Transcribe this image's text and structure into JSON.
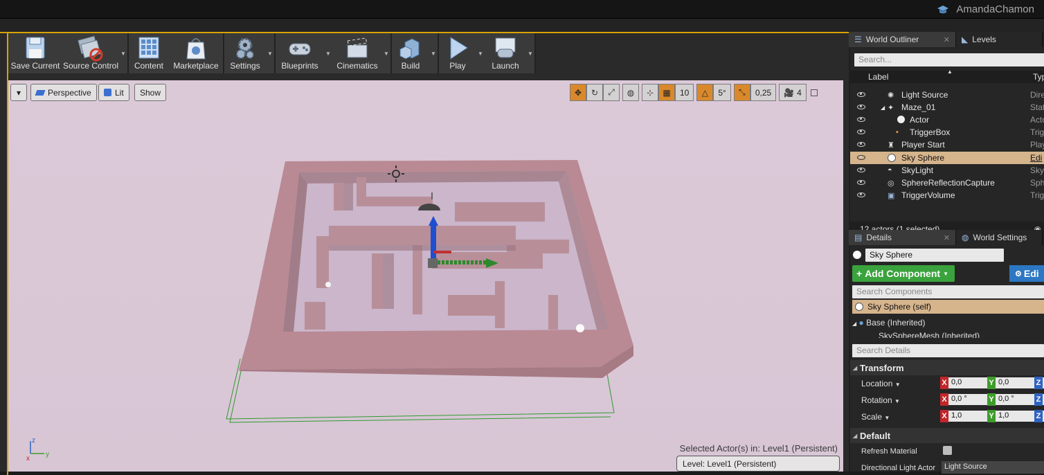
{
  "window": {
    "user_name": "AmandaChamon"
  },
  "toolbar": {
    "buttons": [
      {
        "label": "Save Current",
        "icon": "save-icon"
      },
      {
        "label": "Source Control",
        "icon": "source-control-icon"
      },
      {
        "label": "Content",
        "icon": "content-icon"
      },
      {
        "label": "Marketplace",
        "icon": "marketplace-icon"
      },
      {
        "label": "Settings",
        "icon": "settings-icon"
      },
      {
        "label": "Blueprints",
        "icon": "blueprints-icon"
      },
      {
        "label": "Cinematics",
        "icon": "cinematics-icon"
      },
      {
        "label": "Build",
        "icon": "build-icon"
      },
      {
        "label": "Play",
        "icon": "play-icon"
      },
      {
        "label": "Launch",
        "icon": "launch-icon"
      }
    ]
  },
  "viewport": {
    "perspective_label": "Perspective",
    "lit_label": "Lit",
    "show_label": "Show",
    "grid_snap": "10",
    "rotation_snap": "5°",
    "scale_snap": "0,25",
    "camera_speed": "4",
    "selected_actors_text": "Selected Actor(s) in:  Level1 (Persistent)",
    "level_text": "Level:  Level1 (Persistent)"
  },
  "outliner": {
    "tab_label": "World Outliner",
    "levels_tab_label": "Levels",
    "search_placeholder": "Search...",
    "col_label": "Label",
    "col_type": "Typ",
    "rows": [
      {
        "name": "Light Source",
        "type": "Dire"
      },
      {
        "name": "Maze_01",
        "type": "Stat"
      },
      {
        "name": "Actor",
        "type": "Acto"
      },
      {
        "name": "TriggerBox",
        "type": "Trig"
      },
      {
        "name": "Player Start",
        "type": "Play"
      },
      {
        "name": "Sky Sphere",
        "type": "Edi"
      },
      {
        "name": "SkyLight",
        "type": "Sky"
      },
      {
        "name": "SphereReflectionCapture",
        "type": "Sph"
      },
      {
        "name": "TriggerVolume",
        "type": "Trig"
      }
    ],
    "footer": "12 actors (1 selected)"
  },
  "details": {
    "tab_label": "Details",
    "world_settings_tab_label": "World Settings",
    "actor_name": "Sky Sphere",
    "add_component_label": "Add Component",
    "edit_label": "Edi",
    "search_components_placeholder": "Search Components",
    "self_component": "Sky Sphere (self)",
    "base_inherited": "Base (Inherited)",
    "mesh_inherited": "SkySphereMesh (Inherited)",
    "search_details_placeholder": "Search Details",
    "transform_section": "Transform",
    "location_label": "Location",
    "rotation_label": "Rotation",
    "scale_label": "Scale",
    "location": {
      "x": "0,0",
      "y": "0,0"
    },
    "rotation": {
      "x": "0,0 °",
      "y": "0,0 °"
    },
    "scale": {
      "x": "1,0",
      "y": "1,0"
    },
    "default_section": "Default",
    "refresh_material_label": "Refresh Material",
    "directional_light_label": "Directional Light Actor",
    "directional_light_value": "Light Source"
  },
  "colors": {
    "accent": "#d9a300",
    "selection": "#d6b48c",
    "add_component": "#3aa33d",
    "viewport_bg": "#dcc9d8"
  }
}
